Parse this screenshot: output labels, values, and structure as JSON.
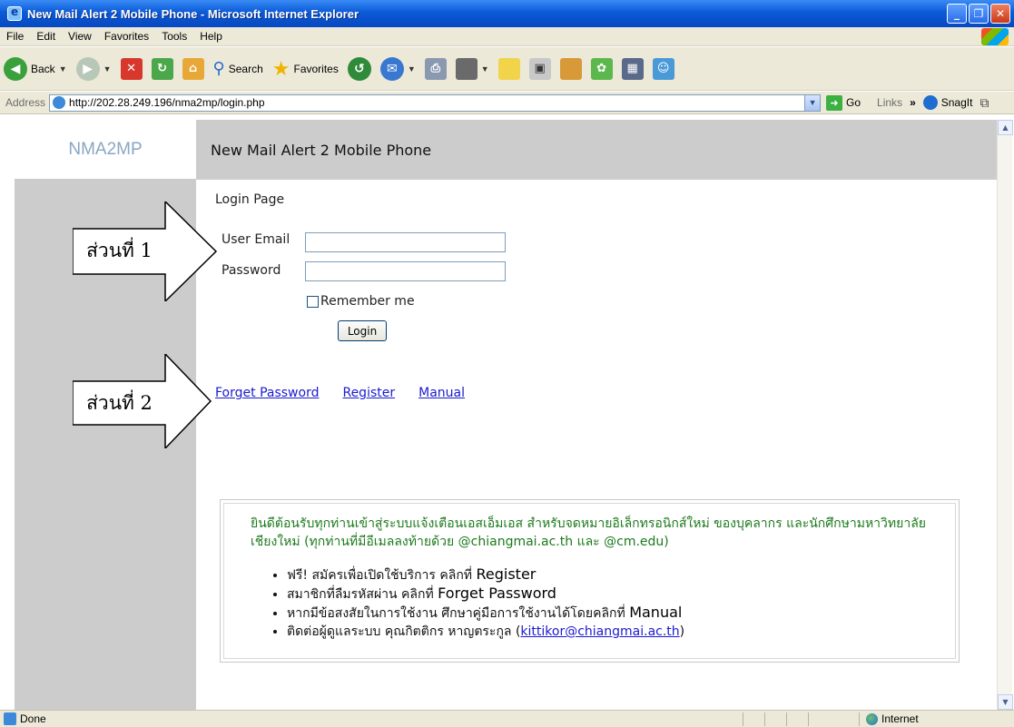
{
  "window": {
    "title": "New Mail Alert 2 Mobile Phone - Microsoft Internet Explorer",
    "buttons": {
      "minimize": "_",
      "maximize": "❐",
      "close": "✕"
    }
  },
  "menu": [
    "File",
    "Edit",
    "View",
    "Favorites",
    "Tools",
    "Help"
  ],
  "toolbar": {
    "back": "Back",
    "search": "Search",
    "favorites": "Favorites"
  },
  "address": {
    "label": "Address",
    "url": "http://202.28.249.196/nma2mp/login.php",
    "go": "Go",
    "links": "Links",
    "more": "»",
    "snagit": "SnagIt"
  },
  "page": {
    "logo": "NMA2MP",
    "header": "New Mail Alert 2 Mobile Phone",
    "login_title": "Login Page",
    "email_label": "User Email",
    "password_label": "Password",
    "remember_label": "Remember me",
    "login_button": "Login",
    "links": {
      "forget": "Forget Password",
      "register": "Register",
      "manual": "Manual"
    },
    "info": {
      "welcome": "ยินดีต้อนรับทุกท่านเข้าสู่ระบบแจ้งเตือนเอสเอ็มเอส สำหรับจดหมายอิเล็กทรอนิกส์ใหม่ ของบุคลากร และนักศึกษามหาวิทยาลัยเชียงใหม่ (ทุกท่านที่มีอีเมลลงท้ายด้วย @chiangmai.ac.th และ @cm.edu)",
      "items": [
        {
          "text": "ฟรี! สมัครเพื่อเปิดใช้บริการ คลิกที่ ",
          "key": "Register"
        },
        {
          "text": "สมาชิกที่ลืมรหัสผ่าน คลิกที่ ",
          "key": "Forget Password"
        },
        {
          "text": "หากมีข้อสงสัยในการใช้งาน ศึกษาคู่มือการใช้งานได้โดยคลิกที่ ",
          "key": "Manual"
        },
        {
          "text": "ติดต่อผู้ดูแลระบบ คุณกิตติกร หาญตระกูล (",
          "key": "kittikor@chiangmai.ac.th",
          "suffix": ")"
        }
      ]
    }
  },
  "annotations": {
    "part1": "ส่วนที่ 1",
    "part2": "ส่วนที่ 2"
  },
  "status": {
    "left": "Done",
    "zone": "Internet"
  }
}
